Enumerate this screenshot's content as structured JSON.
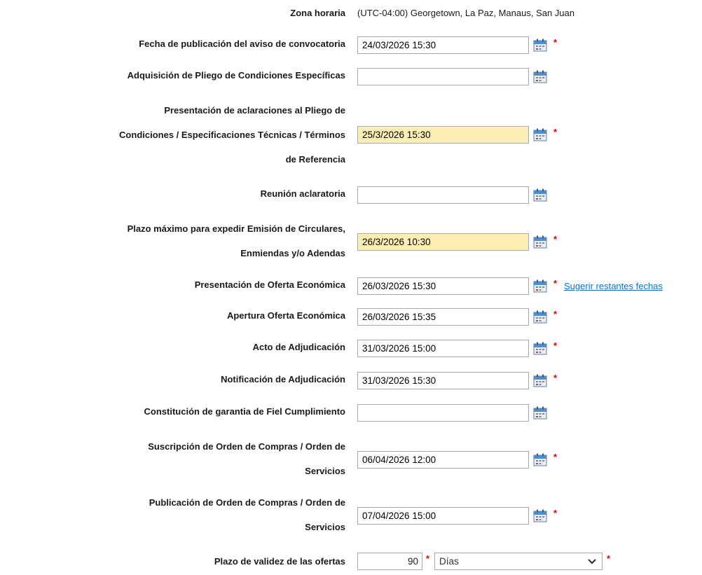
{
  "timezone": {
    "label": "Zona horaria",
    "value": "(UTC-04:00) Georgetown, La Paz, Manaus, San Juan"
  },
  "rows": [
    {
      "label": "Fecha de publicación del aviso de convocatoria",
      "value": "24/03/2026 15:30",
      "required": "*"
    },
    {
      "label": "Adquisición de Pliego de Condiciones Específicas",
      "value": "",
      "required": ""
    },
    {
      "label_lines": [
        "Presentación de aclaraciones al Pliego de",
        "Condiciones / Especificaciones Técnicas / Términos",
        "de Referencia"
      ],
      "value": "25/3/2026 15:30",
      "required": "*",
      "highlighted": true
    },
    {
      "label": "Reunión aclaratoria",
      "value": "",
      "required": ""
    },
    {
      "label_lines": [
        "Plazo máximo para expedir Emisión de Circulares,",
        "Enmiendas y/o Adendas"
      ],
      "value": "26/3/2026 10:30",
      "required": "*",
      "highlighted": true
    },
    {
      "label": "Presentación de Oferta Económica",
      "value": "26/03/2026 15:30",
      "required": "*",
      "link": "Sugerir restantes fechas"
    },
    {
      "label": "Apertura Oferta Económica",
      "value": "26/03/2026 15:35",
      "required": "*"
    },
    {
      "label": "Acto de Adjudicación",
      "value": "31/03/2026 15:00",
      "required": "*"
    },
    {
      "label": "Notificación de Adjudicación",
      "value": "31/03/2026 15:30",
      "required": "*"
    },
    {
      "label": "Constitución de garantia de Fiel Cumplimiento",
      "value": "",
      "required": ""
    },
    {
      "label_lines": [
        "Suscripción de Orden de Compras / Orden de",
        "Servicios"
      ],
      "value": "06/04/2026 12:00",
      "required": "*"
    },
    {
      "label_lines": [
        "Publicación de Orden de Compras / Orden de",
        "Servicios"
      ],
      "value": "07/04/2026 15:00",
      "required": "*"
    }
  ],
  "validity": {
    "label": "Plazo de validez de las ofertas",
    "number": "90",
    "unit": "Días",
    "required": "*"
  },
  "icons": {
    "calendar": "calendar-icon",
    "select_arrow": "chevron-down-icon"
  },
  "colors": {
    "highlight": "#fdeeb3",
    "required": "#e00000",
    "link": "#0b6fd6"
  }
}
